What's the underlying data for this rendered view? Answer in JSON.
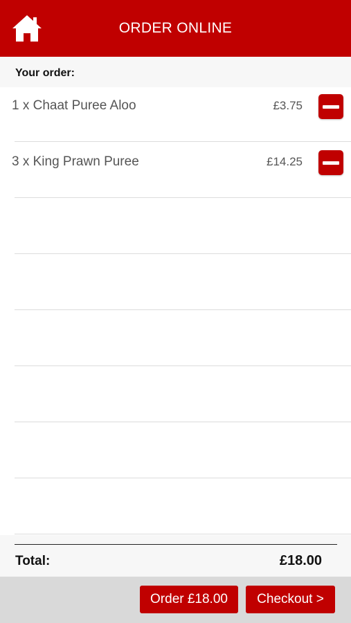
{
  "header": {
    "title": "ORDER ONLINE",
    "home_icon": "home-icon",
    "color": "#c00000"
  },
  "order": {
    "heading": "Your order:",
    "items": [
      {
        "label": "1 x Chaat Puree Aloo",
        "price": "£3.75"
      },
      {
        "label": "3 x King Prawn Puree",
        "price": "£14.25"
      }
    ],
    "total_label": "Total:",
    "total_value": "£18.00"
  },
  "footer": {
    "order_button": "Order £18.00",
    "checkout_button": "Checkout >"
  }
}
